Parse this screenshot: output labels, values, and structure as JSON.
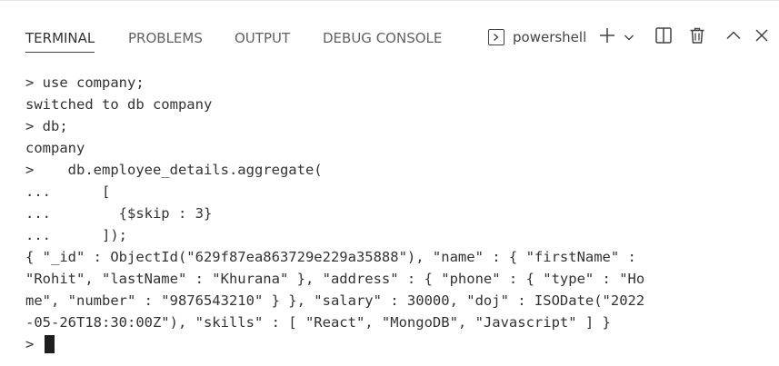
{
  "tabs": [
    {
      "label": "TERMINAL"
    },
    {
      "label": "PROBLEMS"
    },
    {
      "label": "OUTPUT"
    },
    {
      "label": "DEBUG CONSOLE"
    }
  ],
  "active_tab": "TERMINAL",
  "shell": {
    "label": "powershell",
    "icon": "terminal-icon"
  },
  "toolbar_icons": [
    "plus-icon",
    "chevron-down-icon",
    "split-icon",
    "trash-icon",
    "chevron-up-icon",
    "close-icon"
  ],
  "terminal": {
    "lines": [
      "> use company;",
      "switched to db company",
      "> db;",
      "company",
      ">    db.employee_details.aggregate(",
      "...      [",
      "...        {$skip : 3}",
      "...      ]);",
      "{ \"_id\" : ObjectId(\"629f87ea863729e229a35888\"), \"name\" : { \"firstName\" :",
      "\"Rohit\", \"lastName\" : \"Khurana\" }, \"address\" : { \"phone\" : { \"type\" : \"Ho",
      "me\", \"number\" : \"9876543210\" } }, \"salary\" : 30000, \"doj\" : ISODate(\"2022",
      "-05-26T18:30:00Z\"), \"skills\" : [ \"React\", \"MongoDB\", \"Javascript\" ] }"
    ],
    "prompt": ">"
  },
  "colors": {
    "background": "#ffffff",
    "text": "#333333",
    "tab_inactive": "#616161",
    "cursor": "#1e1e1e"
  }
}
